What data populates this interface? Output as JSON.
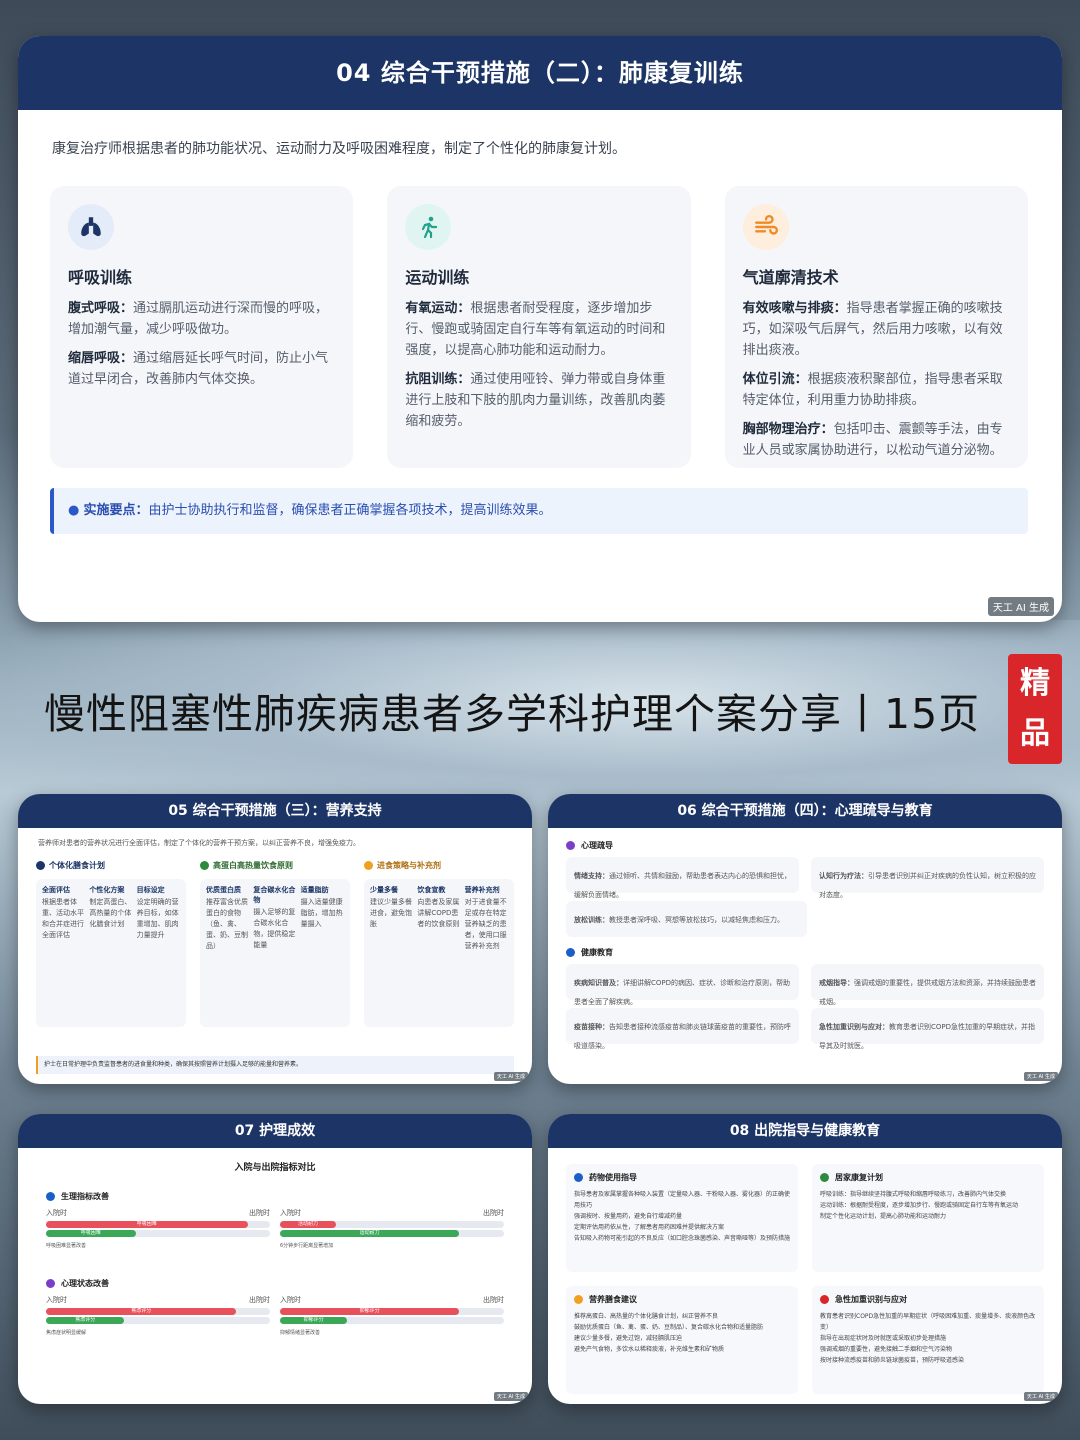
{
  "slide04": {
    "title": "04 综合干预措施（二）：肺康复训练",
    "intro": "康复治疗师根据患者的肺功能状况、运动耐力及呼吸困难程度，制定了个性化的肺康复计划。",
    "cards": [
      {
        "icon": "lungs-icon",
        "title": "呼吸训练",
        "items": [
          {
            "label": "腹式呼吸：",
            "text": "通过膈肌运动进行深而慢的呼吸，增加潮气量，减少呼吸做功。"
          },
          {
            "label": "缩唇呼吸：",
            "text": "通过缩唇延长呼气时间，防止小气道过早闭合，改善肺内气体交换。"
          }
        ]
      },
      {
        "icon": "running-icon",
        "title": "运动训练",
        "items": [
          {
            "label": "有氧运动：",
            "text": "根据患者耐受程度，逐步增加步行、慢跑或骑固定自行车等有氧运动的时间和强度，以提高心肺功能和运动耐力。"
          },
          {
            "label": "抗阻训练：",
            "text": "通过使用哑铃、弹力带或自身体重进行上肢和下肢的肌肉力量训练，改善肌肉萎缩和疲劳。"
          }
        ]
      },
      {
        "icon": "wind-icon",
        "title": "气道廓清技术",
        "items": [
          {
            "label": "有效咳嗽与排痰：",
            "text": "指导患者掌握正确的咳嗽技巧，如深吸气后屏气，然后用力咳嗽，以有效排出痰液。"
          },
          {
            "label": "体位引流：",
            "text": "根据痰液积聚部位，指导患者采取特定体位，利用重力协助排痰。"
          },
          {
            "label": "胸部物理治疗：",
            "text": "包括叩击、震颤等手法，由专业人员或家属协助进行，以松动气道分泌物。"
          }
        ]
      }
    ],
    "tip_label": "实施要点：",
    "tip_text": "由护士协助执行和监督，确保患者正确掌握各项技术，提高训练效果。",
    "watermark": "天工 AI 生成"
  },
  "main_title": "慢性阻塞性肺疾病患者多学科护理个案分享丨15页",
  "badge": [
    "精",
    "品"
  ],
  "slide05": {
    "title": "05 综合干预措施（三）：营养支持",
    "intro": "营养师对患者的营养状况进行全面评估，制定了个体化的营养干预方案，以纠正营养不良，增强免疫力。",
    "cols": [
      {
        "title": "个体化膳食计划",
        "color": "#1c3566",
        "items": [
          {
            "name": "全面评估",
            "text": "根据患者体重、活动水平和合并症进行全面评估"
          },
          {
            "name": "个性化方案",
            "text": "制定高蛋白、高热量的个体化膳食计划"
          },
          {
            "name": "目标设定",
            "text": "设定明确的营养目标，如体重增加、肌肉力量提升"
          }
        ]
      },
      {
        "title": "高蛋白高热量饮食原则",
        "color": "#2e8b3e",
        "items": [
          {
            "name": "优质蛋白质",
            "text": "推荐富含优质蛋白的食物（鱼、禽、蛋、奶、豆制品）"
          },
          {
            "name": "复合碳水化合物",
            "text": "摄入足够的复合碳水化合物，提供稳定能量"
          },
          {
            "name": "适量脂肪",
            "text": "摄入适量健康脂肪，增加热量摄入"
          }
        ]
      },
      {
        "title": "进食策略与补充剂",
        "color": "#c07a10",
        "items": [
          {
            "name": "少量多餐",
            "text": "建议少量多餐进食，避免饱胀"
          },
          {
            "name": "饮食宣教",
            "text": "向患者及家属讲解COPD患者的饮食原则"
          },
          {
            "name": "营养补充剂",
            "text": "对于进食量不足或存在特定营养缺乏的患者，使用口服营养补充剂"
          }
        ]
      }
    ],
    "note": "护士在日常护理中负责监督患者的进食量和种类，确保其按照营养计划摄入足够的能量和营养素。",
    "watermark": "天工 AI 生成"
  },
  "slide06": {
    "title": "06 综合干预措施（四）：心理疏导与教育",
    "sections": [
      {
        "title": "心理疏导",
        "items": [
          {
            "label": "情绪支持：",
            "text": "通过倾听、共情和鼓励，帮助患者表达内心的恐惧和担忧，缓解负面情绪。"
          },
          {
            "label": "认知行为疗法：",
            "text": "引导患者识别并纠正对疾病的负性认知，树立积极的应对态度。"
          },
          {
            "label": "放松训练：",
            "text": "教授患者深呼吸、冥想等放松技巧，以减轻焦虑和压力。"
          }
        ]
      },
      {
        "title": "健康教育",
        "items": [
          {
            "label": "疾病知识普及：",
            "text": "详细讲解COPD的病因、症状、诊断和治疗原则，帮助患者全面了解疾病。"
          },
          {
            "label": "戒烟指导：",
            "text": "强调戒烟的重要性，提供戒烟方法和资源，并持续鼓励患者戒烟。"
          },
          {
            "label": "疫苗接种：",
            "text": "告知患者接种流感疫苗和肺炎链球菌疫苗的重要性，预防呼吸道感染。"
          },
          {
            "label": "急性加重识别与应对：",
            "text": "教育患者识别COPD急性加重的早期症状，并指导其及时就医。"
          }
        ]
      }
    ],
    "watermark": "天工 AI 生成"
  },
  "slide07": {
    "title": "07 护理成效",
    "subtitle": "入院与出院指标对比",
    "groups": [
      {
        "title": "生理指标改善",
        "pairs": [
          {
            "in": "入院时",
            "out": "出院时",
            "bar1": "呼吸困难",
            "bar2": "呼吸困难",
            "in_val": 0.9,
            "out_val": 0.4
          },
          {
            "in": "入院时",
            "out": "出院时",
            "bar1": "活动耐力",
            "bar2": "运动耐力",
            "in_val": 0.25,
            "out_val": 0.8
          }
        ],
        "notes": [
          "呼吸困难显著改善",
          "6分钟步行距离显著增加"
        ]
      },
      {
        "title": "心理状态改善",
        "pairs": [
          {
            "in": "入院时",
            "out": "出院时",
            "bar1": "焦虑评分",
            "bar2": "焦虑评分",
            "in_val": 0.85,
            "out_val": 0.35
          },
          {
            "in": "入院时",
            "out": "出院时",
            "bar1": "抑郁评分",
            "bar2": "抑郁评分",
            "in_val": 0.8,
            "out_val": 0.3
          }
        ],
        "notes": [
          "焦虑症状明显缓解",
          "抑郁情绪显著改善"
        ]
      }
    ],
    "watermark": "天工 AI 生成"
  },
  "slide08": {
    "title": "08 出院指导与健康教育",
    "blocks": [
      {
        "title": "药物使用指导",
        "items": [
          "指导患者及家属掌握各种吸入装置（定量吸入器、干粉吸入器、雾化器）的正确使用技巧",
          "强调按时、按量用药，避免自行增减药量",
          "定期评估用药依从性，了解患者用药困难并提供解决方案",
          "告知吸入药物可能引起的不良反应（如口腔念珠菌感染、声音嘶哑等）及预防措施"
        ]
      },
      {
        "title": "居家康复计划",
        "items": [
          "呼吸训练：指导继续坚持腹式呼吸和缩唇呼吸练习，改善肺内气体交换",
          "运动训练：根据耐受程度，逐步增加步行、慢跑或骑固定自行车等有氧运动",
          "制定个性化运动计划，提高心肺功能和运动耐力"
        ]
      },
      {
        "title": "营养膳食建议",
        "items": [
          "推荐高蛋白、高热量的个体化膳食计划，纠正营养不良",
          "鼓励优质蛋白（鱼、禽、蛋、奶、豆制品）、复合碳水化合物和适量脂肪",
          "建议少量多餐，避免过饱，减轻膈肌压迫",
          "避免产气食物，多饮水以稀释痰液，补充维生素和矿物质"
        ]
      },
      {
        "title": "急性加重识别与应对",
        "items": [
          "教育患者识别COPD急性加重的早期症状（呼吸困难加重、痰量增多、痰液颜色改变）",
          "指导在出现症状时及时就医或采取初步处理措施",
          "强调戒烟的重要性，避免接触二手烟和空气污染物",
          "按时接种流感疫苗和肺炎链球菌疫苗，预防呼吸道感染"
        ]
      }
    ],
    "watermark": "天工 AI 生成"
  }
}
